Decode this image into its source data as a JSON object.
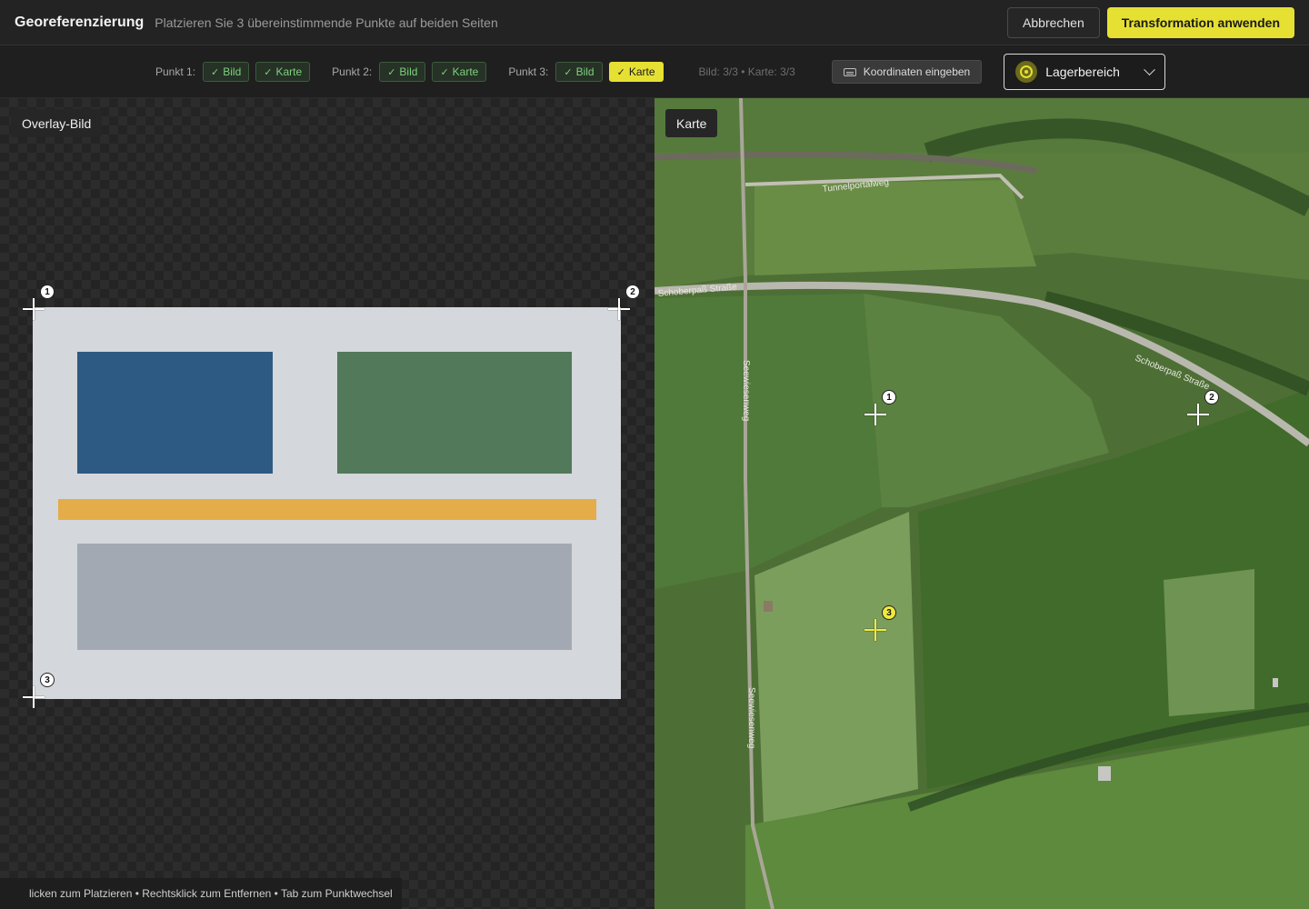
{
  "header": {
    "title": "Georeferenzierung",
    "subtitle": "Platzieren Sie 3 übereinstimmende Punkte auf beiden Seiten",
    "cancel_label": "Abbrechen",
    "apply_label": "Transformation anwenden"
  },
  "toolbar": {
    "points": [
      {
        "label": "Punkt 1:",
        "image_chip": "Bild",
        "map_chip": "Karte"
      },
      {
        "label": "Punkt 2:",
        "image_chip": "Bild",
        "map_chip": "Karte"
      },
      {
        "label": "Punkt 3:",
        "image_chip": "Bild",
        "map_chip": "Karte"
      }
    ],
    "counts": "Bild: 3/3 • Karte: 3/3",
    "coords_button": "Koordinaten eingeben",
    "area_select": "Lagerbereich"
  },
  "left_panel": {
    "label": "Overlay-Bild",
    "markers": [
      "1",
      "2",
      "3"
    ],
    "hint": "licken zum Platzieren • Rechtsklick zum Entfernen • Tab zum Punktwechsel"
  },
  "map_panel": {
    "label": "Karte",
    "markers": [
      "1",
      "2",
      "3"
    ],
    "road_labels": {
      "tunnel": "Tunnelportalweg",
      "schobers_left": "Schoberpaß Straße",
      "schobers_right": "Schoberpaß Straße",
      "seewiesen_top": "Seewiesenweg",
      "seewiesen_bottom": "Seewiesenweg"
    }
  },
  "colors": {
    "accent": "#e6e033",
    "success": "#7fd07f",
    "block_blue": "#2d5a82",
    "block_green": "#52795a",
    "block_orange": "#e4ad4a",
    "block_gray": "#a2a9b3"
  },
  "icons": [
    "check-icon",
    "keyboard-icon",
    "target-icon",
    "chevron-down-icon",
    "crosshair-icon",
    "app-logo-icon"
  ]
}
